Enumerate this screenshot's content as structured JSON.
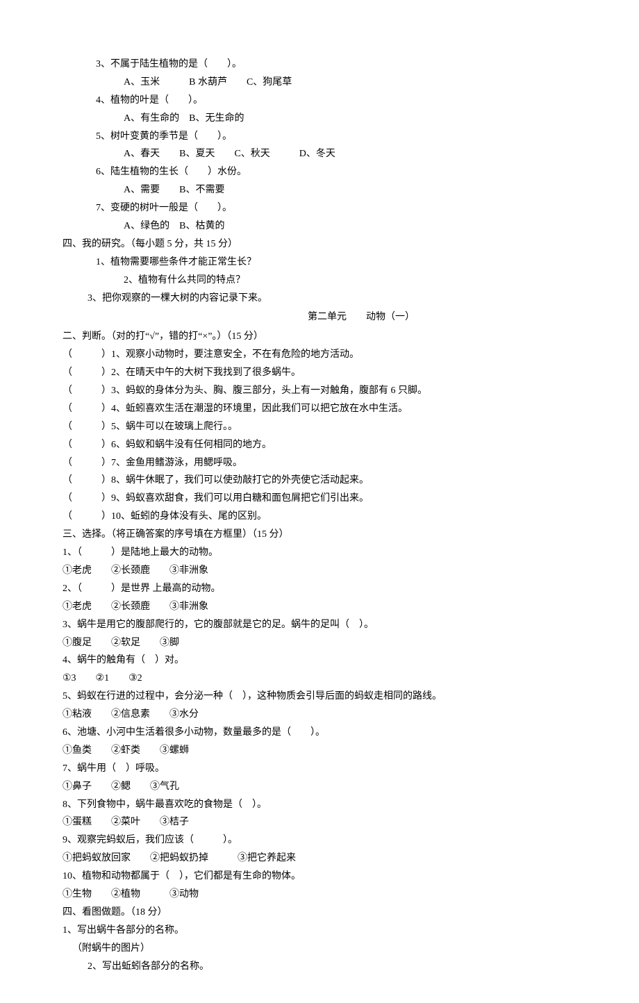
{
  "top_section": {
    "q3": {
      "stem": "3、不属于陆生植物的是（　　）。",
      "opts": "A、玉米　　　B 水葫芦　　C、狗尾草"
    },
    "q4": {
      "stem": "4、植物的叶是（　　）。",
      "opts": "A、有生命的　B、无生命的"
    },
    "q5": {
      "stem": "5、树叶变黄的季节是（　　）。",
      "opts": "A、春天　　B、夏天　　C、秋天　　　D、冬天"
    },
    "q6": {
      "stem": "6、陆生植物的生长（　　）水份。",
      "opts": "A、需要　　B、不需要"
    },
    "q7": {
      "stem": "7、变硬的树叶一般是（　　）。",
      "opts": "A、绿色的　B、枯黄的"
    }
  },
  "section4": {
    "heading": "四、我的研究。（每小题 5 分，共 15 分）",
    "q1": "1、植物需要哪些条件才能正常生长？",
    "q2": "2、植物有什么共同的特点？",
    "q3": "3、把你观察的一棵大树的内容记录下来。"
  },
  "unit2_title": "第二单元　　动物（一）",
  "section2": {
    "heading": "二、判断。（对的打“√”，错的打“×”。）（15 分）",
    "items": [
      "（　　　）1、观察小动物时，要注意安全，不在有危险的地方活动。",
      "（　　　）2、在晴天中午的大树下我找到了很多蜗牛。",
      "（　　　）3、蚂蚁的身体分为头、胸、腹三部分，头上有一对触角，腹部有 6 只脚。",
      "（　　　）4、蚯蚓喜欢生活在潮湿的环境里，因此我们可以把它放在水中生活。",
      "（　　　）5、蜗牛可以在玻璃上爬行。。",
      "（　　　）6、蚂蚁和蜗牛没有任何相同的地方。",
      "（　　　）7、金鱼用鳍游泳，用鳃呼吸。",
      "（　　　）8、蜗牛休眠了，我们可以使劲敲打它的外壳使它活动起来。",
      "（　　　）9、蚂蚁喜欢甜食，我们可以用白糖和面包屑把它们引出来。",
      "（　　　）10、蚯蚓的身体没有头、尾的区别。"
    ]
  },
  "section3": {
    "heading": "三、选择。（将正确答案的序号填在方框里）（15 分）",
    "q1": {
      "stem": "1、（　　　）是陆地上最大的动物。",
      "opts": "①老虎　　②长颈鹿　　③非洲象"
    },
    "q2": {
      "stem": "2、（　　　）是世界 上最高的动物。",
      "opts": "①老虎　　②长颈鹿　　③非洲象"
    },
    "q3": {
      "stem": "3、蜗牛是用它的腹部爬行的，它的腹部就是它的足。蜗牛的足叫（　）。",
      "opts": "①腹足　　②软足　　③脚"
    },
    "q4": {
      "stem": "4、蜗牛的触角有（　）对。",
      "opts": "①3　　②1　　③2"
    },
    "q5": {
      "stem": "5、蚂蚁在行进的过程中，会分泌一种（　），这种物质会引导后面的蚂蚁走相同的路线。",
      "opts": "①粘液　　②信息素　　③水分"
    },
    "q6": {
      "stem": "6、池塘、小河中生活着很多小动物，数量最多的是（　　）。",
      "opts": "①鱼类　　②虾类　　③螺蛳"
    },
    "q7": {
      "stem": "7、蜗牛用（　）呼吸。",
      "opts": "①鼻子　　②鳃　　③气孔"
    },
    "q8": {
      "stem": "8、下列食物中，蜗牛最喜欢吃的食物是（　）。",
      "opts": "①蛋糕　　②菜叶　　③桔子"
    },
    "q9": {
      "stem": "9、观察完蚂蚁后，我们应该（　　　）。",
      "opts": "①把蚂蚁放回家　　②把蚂蚁扔掉　　　③把它养起来"
    },
    "q10": {
      "stem": "10、植物和动物都属于（　），它们都是有生命的物体。",
      "opts": "①生物　　②植物　　　③动物"
    }
  },
  "section4b": {
    "heading": "四、看图做题。（18 分）",
    "q1": "1、写出蜗牛各部分的名称。",
    "note": "（附蜗牛的图片）",
    "q2": "2、写出蚯蚓各部分的名称。"
  }
}
